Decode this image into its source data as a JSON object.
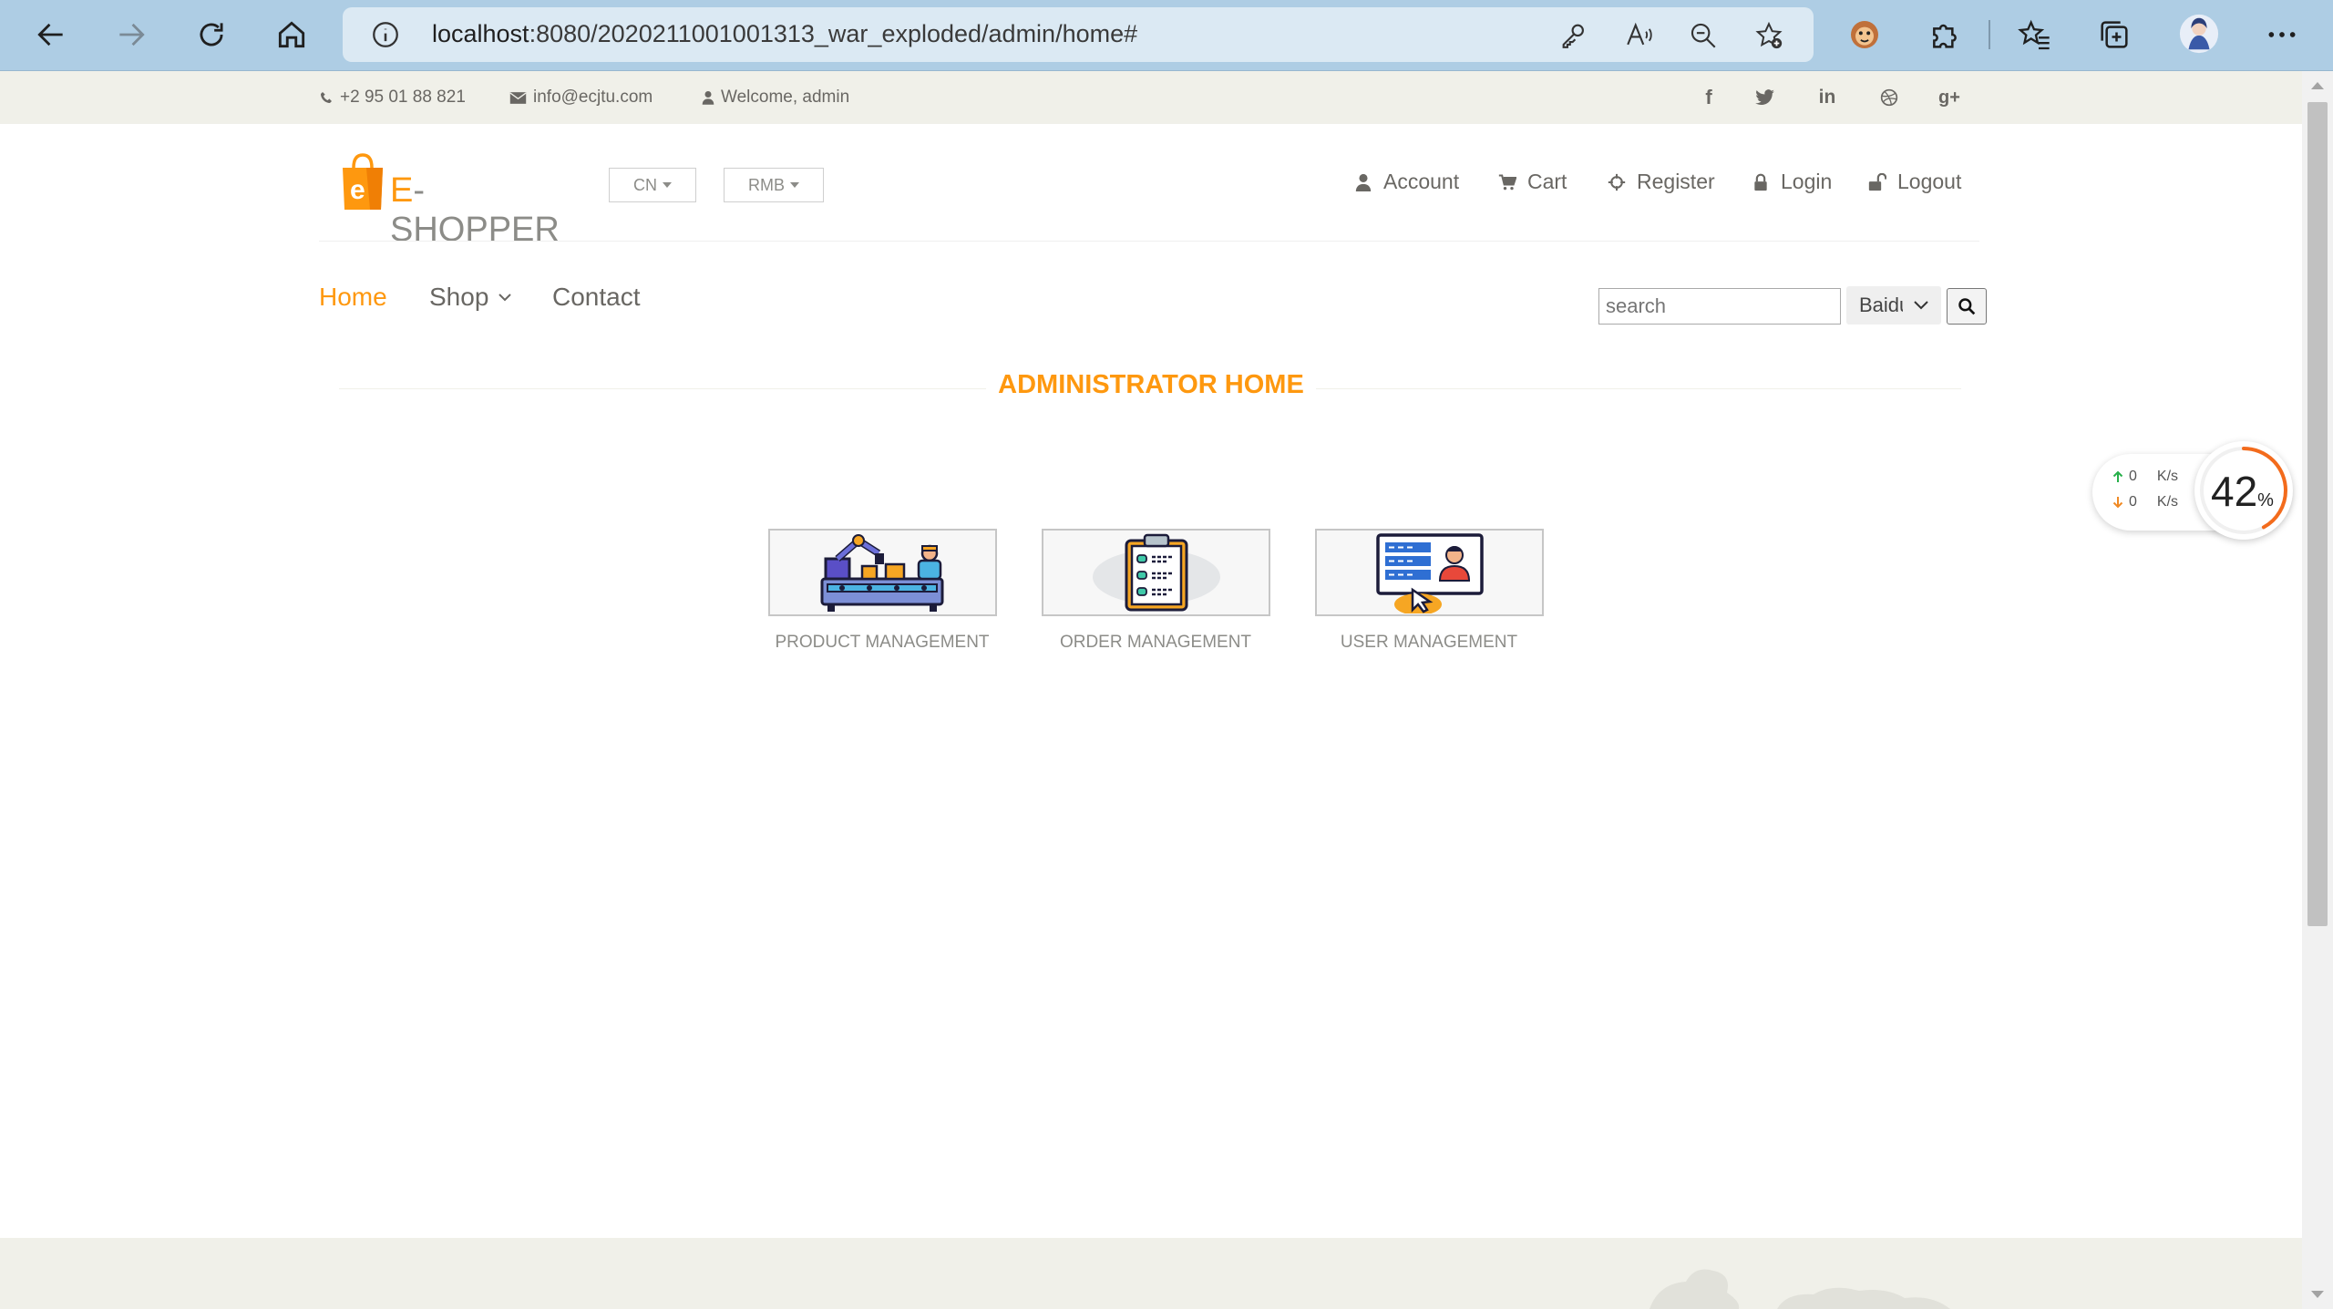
{
  "browser": {
    "url_host": "localhost",
    "url_path": ":8080/2020211001001313_war_exploded/admin/home#"
  },
  "topbar": {
    "phone": "+2 95 01 88 821",
    "email": "info@ecjtu.com",
    "welcome": "Welcome, admin",
    "social": [
      "f",
      "twitter",
      "in",
      "dribbble",
      "g+"
    ]
  },
  "header": {
    "logo_prefix": "E",
    "logo_text": "-SHOPPER",
    "language": "CN",
    "currency": "RMB",
    "links": [
      "Account",
      "Cart",
      "Register",
      "Login",
      "Logout"
    ]
  },
  "nav": {
    "home": "Home",
    "shop": "Shop",
    "contact": "Contact",
    "search_placeholder": "search",
    "engine": "Baidu"
  },
  "main": {
    "title": "ADMINISTRATOR HOME",
    "tiles": [
      "PRODUCT MANAGEMENT",
      "ORDER MANAGEMENT",
      "USER MANAGEMENT"
    ]
  },
  "network": {
    "up_value": "0",
    "down_value": "0",
    "unit": "K/s",
    "percent_value": 42,
    "percent": "42",
    "percent_sign": "%"
  },
  "colors": {
    "accent": "#fe980f",
    "chrome": "#aecde4",
    "bar": "#f0f0e9"
  }
}
